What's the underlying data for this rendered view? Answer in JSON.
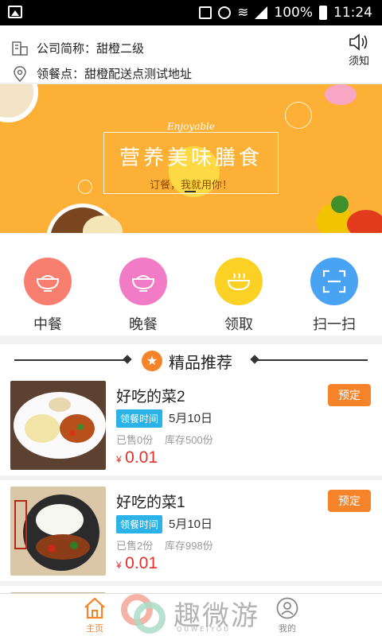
{
  "status_bar": {
    "battery": "100%",
    "time": "11:24"
  },
  "header": {
    "company_label": "公司简称：甜橙二级",
    "pickup_label": "领餐点：甜橙配送点测试地址",
    "notice_label": "须知"
  },
  "banner": {
    "tagline": "Enjoyable",
    "title": "营养美味膳食",
    "subtitle": "订餐，我就用你！"
  },
  "categories": [
    {
      "label": "中餐",
      "color": "#f87f6f",
      "icon": "rice-bowl-icon"
    },
    {
      "label": "晚餐",
      "color": "#f27bc6",
      "icon": "rice-bowl-icon"
    },
    {
      "label": "领取",
      "color": "#fbd126",
      "icon": "soup-bowl-icon"
    },
    {
      "label": "扫一扫",
      "color": "#48a3f2",
      "icon": "scan-icon"
    }
  ],
  "recommend": {
    "title": "精品推荐"
  },
  "products": [
    {
      "name": "好吃的菜2",
      "badge": "领餐时间",
      "date": "5月10日",
      "sold": "已售0份",
      "stock": "库存500份",
      "currency": "¥",
      "price": "0.01",
      "action": "预定"
    },
    {
      "name": "好吃的菜1",
      "badge": "领餐时间",
      "date": "5月10日",
      "sold": "已售2份",
      "stock": "库存998份",
      "currency": "¥",
      "price": "0.01",
      "action": "预定"
    }
  ],
  "nav": {
    "home": "主页",
    "mine": "我的"
  },
  "watermark": {
    "text": "趣微游",
    "sub": "QUWEIYOU"
  },
  "colors": {
    "accent": "#f5832a",
    "badge": "#2bb3e8",
    "price": "#e3302c",
    "banner": "#fcb035"
  }
}
